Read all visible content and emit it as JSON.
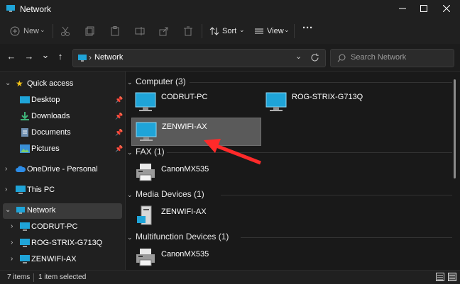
{
  "window": {
    "title": "Network"
  },
  "toolbar": {
    "new_label": "New",
    "sort_label": "Sort",
    "view_label": "View",
    "more_label": "···"
  },
  "navigation": {
    "back": "←",
    "forward": "→",
    "recent": "⌄",
    "up": "↑"
  },
  "address": {
    "separator": "›",
    "location": "Network"
  },
  "search": {
    "placeholder": "Search Network"
  },
  "sidebar": {
    "quick_access": "Quick access",
    "items": [
      {
        "label": "Desktop"
      },
      {
        "label": "Downloads"
      },
      {
        "label": "Documents"
      },
      {
        "label": "Pictures"
      },
      {
        "label": "OneDrive - Personal"
      },
      {
        "label": "This PC"
      },
      {
        "label": "Network"
      },
      {
        "label": "CODRUT-PC"
      },
      {
        "label": "ROG-STRIX-G713Q"
      },
      {
        "label": "ZENWIFI-AX"
      }
    ]
  },
  "content": {
    "groups": [
      {
        "header": "Computer (3)",
        "items": [
          "CODRUT-PC",
          "ROG-STRIX-G713Q",
          "ZENWIFI-AX"
        ]
      },
      {
        "header": "FAX (1)",
        "items": [
          "CanonMX535"
        ]
      },
      {
        "header": "Media Devices (1)",
        "items": [
          "ZENWIFI-AX"
        ]
      },
      {
        "header": "Multifunction Devices (1)",
        "items": [
          "CanonMX535"
        ]
      }
    ]
  },
  "status": {
    "items_count": "7 items",
    "selected": "1 item selected"
  },
  "colors": {
    "accent": "#ff2a2a",
    "selection": "#5a5a5a",
    "monitor": "#1fa4d8"
  }
}
